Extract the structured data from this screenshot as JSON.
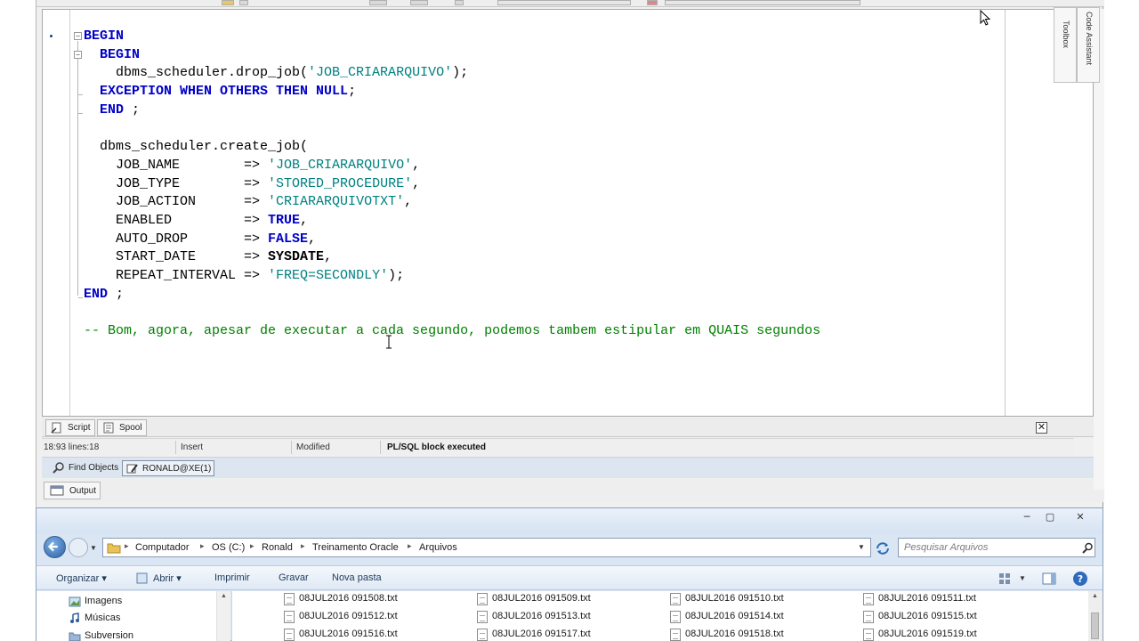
{
  "ide": {
    "code_lines": [
      [
        {
          "t": "BEGIN",
          "c": "kw"
        }
      ],
      [
        {
          "t": "  "
        },
        {
          "t": "BEGIN",
          "c": "kw"
        }
      ],
      [
        {
          "t": "    dbms_scheduler.drop_job("
        },
        {
          "t": "'JOB_CRIARARQUIVO'",
          "c": "str"
        },
        {
          "t": ");"
        }
      ],
      [
        {
          "t": "  "
        },
        {
          "t": "EXCEPTION WHEN OTHERS THEN NULL",
          "c": "kw"
        },
        {
          "t": ";"
        }
      ],
      [
        {
          "t": "  "
        },
        {
          "t": "END",
          "c": "kw"
        },
        {
          "t": " ;"
        }
      ],
      [
        {
          "t": ""
        }
      ],
      [
        {
          "t": "  dbms_scheduler.create_job("
        }
      ],
      [
        {
          "t": "    JOB_NAME        => "
        },
        {
          "t": "'JOB_CRIARARQUIVO'",
          "c": "str"
        },
        {
          "t": ","
        }
      ],
      [
        {
          "t": "    JOB_TYPE        => "
        },
        {
          "t": "'STORED_PROCEDURE'",
          "c": "str"
        },
        {
          "t": ","
        }
      ],
      [
        {
          "t": "    JOB_ACTION      => "
        },
        {
          "t": "'CRIARARQUIVOTXT'",
          "c": "str"
        },
        {
          "t": ","
        }
      ],
      [
        {
          "t": "    ENABLED         => "
        },
        {
          "t": "TRUE",
          "c": "kw"
        },
        {
          "t": ","
        }
      ],
      [
        {
          "t": "    AUTO_DROP       => "
        },
        {
          "t": "FALSE",
          "c": "kw"
        },
        {
          "t": ","
        }
      ],
      [
        {
          "t": "    START_DATE      => "
        },
        {
          "t": "SYSDATE",
          "c": "kwb"
        },
        {
          "t": ","
        }
      ],
      [
        {
          "t": "    REPEAT_INTERVAL => "
        },
        {
          "t": "'FREQ=SECONDLY'",
          "c": "str"
        },
        {
          "t": ");"
        }
      ],
      [
        {
          "t": "END",
          "c": "kw"
        },
        {
          "t": " ;"
        }
      ],
      [
        {
          "t": ""
        }
      ],
      [
        {
          "t": "-- Bom, agora, apesar de executar a cada segundo, podemos tambem estipular em QUAIS segundos",
          "c": "cmt"
        }
      ]
    ],
    "side_tabs": {
      "code_assistant": "Code Assistant",
      "toolbox": "Toolbox"
    },
    "tabs": {
      "script": "Script",
      "spool": "Spool"
    },
    "close_glyph": "✕",
    "status": {
      "position": "18:93 lines:18",
      "mode": "Insert",
      "modified": "Modified",
      "message": "PL/SQL block executed"
    },
    "connection_bar": {
      "find_objects": "Find Objects",
      "connection": "RONALD@XE(1)"
    },
    "output_label": "Output",
    "icons": [
      "script-icon",
      "spool-icon",
      "find-objects-icon",
      "connection-icon",
      "output-icon"
    ]
  },
  "explorer": {
    "window_buttons": {
      "minimize": "─",
      "maximize": "▢",
      "close": "✕"
    },
    "breadcrumb": [
      "Computador",
      "OS (C:)",
      "Ronald",
      "Treinamento Oracle",
      "Arquivos"
    ],
    "breadcrumb_sep": "▸",
    "search_placeholder": "Pesquisar Arquivos",
    "toolbar": {
      "organize": "Organizar ▾",
      "open": "Abrir ▾",
      "print": "Imprimir",
      "burn": "Gravar",
      "new_folder": "Nova pasta"
    },
    "nav_items": [
      "Imagens",
      "Músicas",
      "Subversion"
    ],
    "files": [
      "08JUL2016 091508.txt",
      "08JUL2016 091509.txt",
      "08JUL2016 091510.txt",
      "08JUL2016 091511.txt",
      "08JUL2016 091512.txt",
      "08JUL2016 091513.txt",
      "08JUL2016 091514.txt",
      "08JUL2016 091515.txt",
      "08JUL2016 091516.txt",
      "08JUL2016 091517.txt",
      "08JUL2016 091518.txt",
      "08JUL2016 091519.txt"
    ],
    "colors": {
      "accent": "#1e395b",
      "frame": "#dbe6f4"
    }
  }
}
